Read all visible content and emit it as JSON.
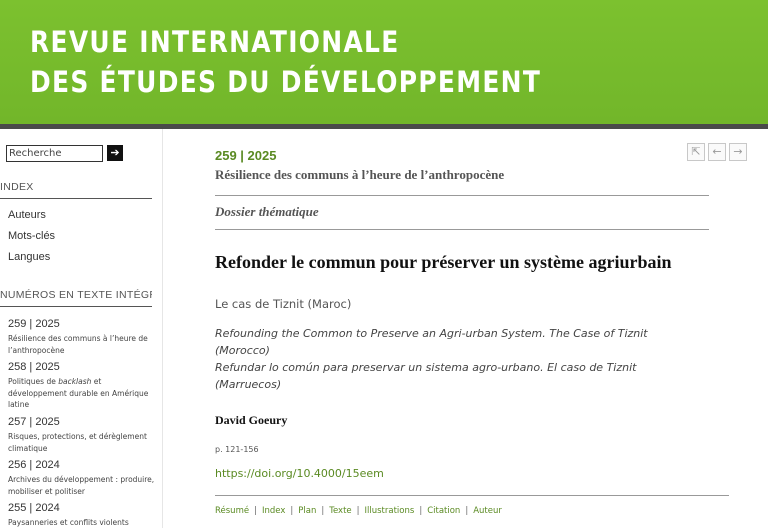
{
  "header": {
    "title_line1": "REVUE INTERNATIONALE",
    "title_line2": "DES ÉTUDES DU DÉVELOPPEMENT"
  },
  "sidebar": {
    "search": {
      "placeholder": "Recherche",
      "button_icon": "arrow-right-icon"
    },
    "index_heading": "INDEX",
    "index_links": [
      "Auteurs",
      "Mots-clés",
      "Langues"
    ],
    "issues_heading": "NUMÉROS EN TEXTE INTÉGRAL",
    "issues": [
      {
        "number": "259 | 2025",
        "title": "Résilience des communs à l’heure de l’anthropocène"
      },
      {
        "number": "258 | 2025",
        "title_pre": "Politiques de ",
        "title_em": "backlash",
        "title_post": " et développement durable en Amérique latine"
      },
      {
        "number": "257 | 2025",
        "title": "Risques, protections, et dérèglement climatique"
      },
      {
        "number": "256 | 2024",
        "title": "Archives du développement : produire, mobiliser et politiser"
      },
      {
        "number": "255 | 2024",
        "title": "Paysanneries et conflits violents"
      }
    ]
  },
  "nav": {
    "icons": [
      "first-page-icon",
      "prev-page-icon",
      "next-page-icon"
    ],
    "glyphs": [
      "⇱",
      "←",
      "→"
    ]
  },
  "article": {
    "issue_number": "259 | 2025",
    "issue_title": "Résilience des communs à l’heure de l’anthropocène",
    "section": "Dossier thématique",
    "title": "Refonder le commun pour préserver un système agriurbain",
    "subtitle": "Le cas de Tiznit (Maroc)",
    "alt_title_en": "Refounding the Common to Preserve an Agri-urban System. The Case of Tiznit (Morocco)",
    "alt_title_es": "Refundar lo común para preservar un sistema agro-urbano. El caso de Tiznit (Marruecos)",
    "author": "David Goeury",
    "pages": "p. 121-156",
    "doi": "https://doi.org/10.4000/15eem",
    "tabs": [
      "Résumé",
      "Index",
      "Plan",
      "Texte",
      "Illustrations",
      "Citation",
      "Auteur"
    ]
  },
  "colors": {
    "banner": "#76bb2c",
    "accent_green": "#5a8a22",
    "banner_rule": "#4a4a4a"
  }
}
